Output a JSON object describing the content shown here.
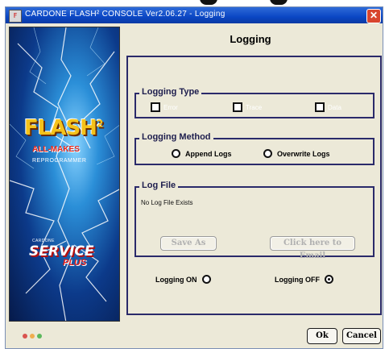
{
  "window": {
    "title": "CARDONE FLASH² CONSOLE Ver2.06.27 - Logging",
    "app_icon": "app-icon",
    "close_glyph": "✕"
  },
  "branding": {
    "flash": "FLASH",
    "flash_sup": "2",
    "all_makes": "ALL-MAKES",
    "reprogrammer": "REPROGRAMMER",
    "cardone": "CARDONE",
    "service": "SERVICE",
    "plus": "PLUS"
  },
  "page": {
    "title": "Logging"
  },
  "logging_type": {
    "legend": "Logging Type",
    "options": [
      {
        "label": "Error",
        "checked": false
      },
      {
        "label": "Trace",
        "checked": false
      },
      {
        "label": "Data",
        "checked": false
      }
    ]
  },
  "logging_method": {
    "legend": "Logging Method",
    "options": [
      {
        "label": "Append Logs",
        "selected": false
      },
      {
        "label": "Overwrite Logs",
        "selected": false
      }
    ]
  },
  "log_file": {
    "legend": "Log File",
    "status": "No Log File Exists",
    "save_as_label": "Save As",
    "email_label": "Click here to Email"
  },
  "logging_state": {
    "on_label": "Logging ON",
    "on_selected": false,
    "off_label": "Logging OFF",
    "off_selected": true
  },
  "footer": {
    "ok_label": "Ok",
    "cancel_label": "Cancel",
    "status_colors": [
      "#d9534f",
      "#f0ad4e",
      "#5cb85c"
    ]
  },
  "colors": {
    "titlebar": "#0a46c4",
    "accent_text": "#1d1d4d",
    "window_bg": "#ece9d8"
  }
}
